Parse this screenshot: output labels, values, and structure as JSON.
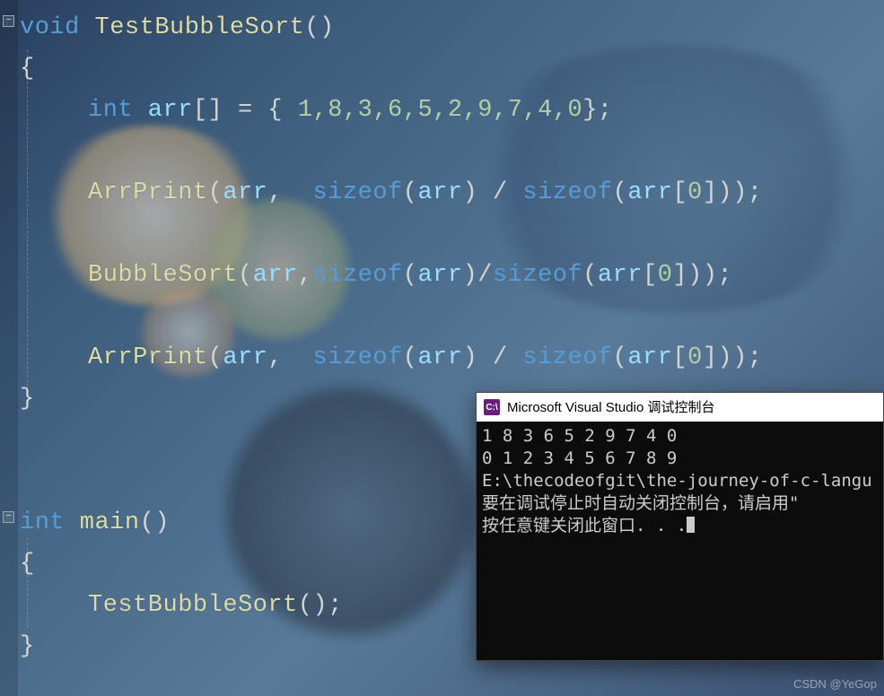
{
  "editor": {
    "fold_glyph": "−",
    "lines": {
      "l1": {
        "kw": "void",
        "fn": " TestBubbleSort",
        "rest": "()"
      },
      "l2": {
        "brace": "{"
      },
      "l3": {
        "kw": "int",
        "var": " arr",
        "mid": "[] = { ",
        "nums": "1,8,3,6,5,2,9,7,4,0",
        "end": "};"
      },
      "l5": {
        "fn": "ArrPrint",
        "open": "(",
        "arg1": "arr",
        "comma": ", ",
        "kw1": " sizeof",
        "p1": "(",
        "a1": "arr",
        "p2": ") / ",
        "kw2": "sizeof",
        "p3": "(",
        "a2": "arr",
        "idx": "[",
        "zero": "0",
        "idx2": "]));"
      },
      "l7": {
        "fn": "BubbleSort",
        "open": "(",
        "arg1": "arr",
        "comma": ",",
        "kw1": "sizeof",
        "p1": "(",
        "a1": "arr",
        "p2": ")/",
        "kw2": "sizeof",
        "p3": "(",
        "a2": "arr",
        "idx": "[",
        "zero": "0",
        "idx2": "]));"
      },
      "l9": {
        "fn": "ArrPrint",
        "open": "(",
        "arg1": "arr",
        "comma": ", ",
        "kw1": " sizeof",
        "p1": "(",
        "a1": "arr",
        "p2": ") / ",
        "kw2": "sizeof",
        "p3": "(",
        "a2": "arr",
        "idx": "[",
        "zero": "0",
        "idx2": "]));"
      },
      "l10": {
        "brace": "}"
      },
      "l13": {
        "kw": "int",
        "fn": " main",
        "rest": "()"
      },
      "l14": {
        "brace": "{"
      },
      "l15": {
        "fn": "TestBubbleSort",
        "rest": "();"
      },
      "l16": {
        "brace": "}"
      }
    }
  },
  "console": {
    "title": "Microsoft Visual Studio 调试控制台",
    "icon_text": "C:\\",
    "out1": "1 8 3 6 5 2 9 7 4 0",
    "out2": "0 1 2 3 4 5 6 7 8 9",
    "blank": "",
    "path": "E:\\thecodeofgit\\the-journey-of-c-langu",
    "msg1": "要在调试停止时自动关闭控制台，请启用\"",
    "msg2": "按任意键关闭此窗口. . ."
  },
  "watermark": "CSDN @YeGop"
}
